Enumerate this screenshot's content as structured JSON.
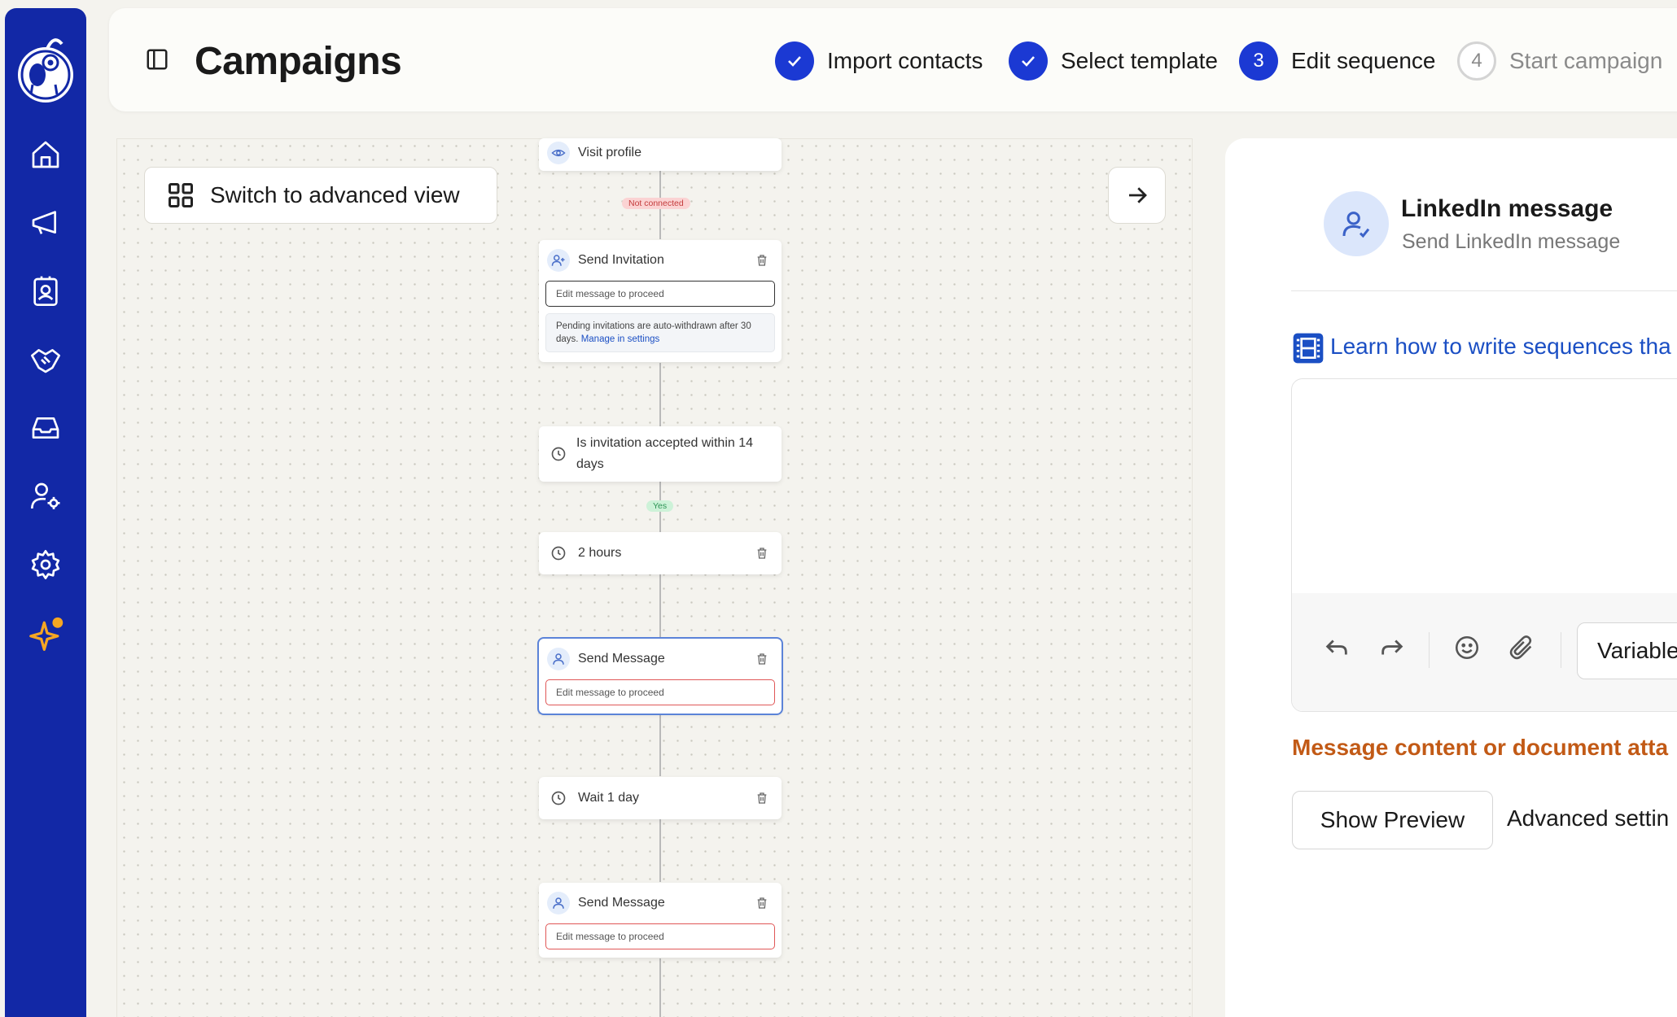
{
  "app": {
    "title": "Campaigns"
  },
  "steps": [
    {
      "label": "Import contacts",
      "state": "done"
    },
    {
      "label": "Select template",
      "state": "done"
    },
    {
      "label": "Edit sequence",
      "state": "active",
      "number": "3"
    },
    {
      "label": "Start campaign",
      "state": "todo",
      "number": "4"
    }
  ],
  "canvas": {
    "advanced_view_label": "Switch to advanced view",
    "tags": {
      "not_connected": "Not connected",
      "yes": "Yes"
    },
    "nodes": {
      "visit_profile": {
        "title": "Visit profile"
      },
      "send_invitation": {
        "title": "Send Invitation",
        "input_placeholder": "Edit message to proceed",
        "note": "Pending invitations are auto-withdrawn after 30 days.",
        "note_link": "Manage in settings"
      },
      "condition": {
        "title": "Is invitation accepted within 14 days"
      },
      "delay": {
        "title": "2 hours"
      },
      "send_message_1": {
        "title": "Send Message",
        "input_placeholder": "Edit message to proceed"
      },
      "wait": {
        "title": "Wait 1 day"
      },
      "send_message_2": {
        "title": "Send Message",
        "input_placeholder": "Edit message to proceed"
      }
    }
  },
  "panel": {
    "title": "LinkedIn message",
    "subtitle": "Send LinkedIn message",
    "learn_link": "Learn how to write sequences tha",
    "variable_button": "Variable",
    "error": "Message content or document atta",
    "show_preview": "Show Preview",
    "advanced_settings": "Advanced settin"
  },
  "colors": {
    "sidebar": "#1228a6",
    "accent": "#1b39d3",
    "link": "#1b4fc4",
    "error": "#c25a16",
    "notification_dot": "#f5a623"
  },
  "sidebar": {
    "icons": [
      "home-icon",
      "megaphone-icon",
      "contacts-icon",
      "handshake-icon",
      "inbox-icon",
      "user-settings-icon",
      "settings-icon",
      "sparkles-icon"
    ]
  }
}
